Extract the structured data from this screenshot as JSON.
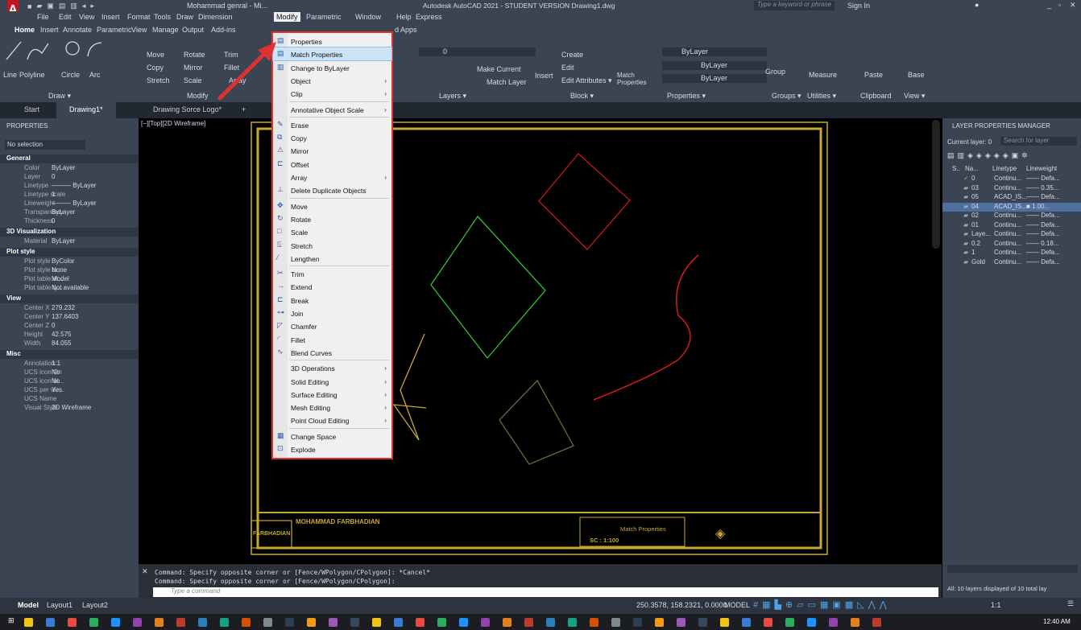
{
  "window": {
    "title": "Autodesk AutoCAD 2021 - STUDENT VERSION Drawing1.dwg",
    "user": "Mohammad genral - Mi...",
    "search_placeholder": "Type a keyword or phrase",
    "sign_in": "Sign In"
  },
  "menubar": [
    "File",
    "Edit",
    "View",
    "Insert",
    "Format",
    "Tools",
    "Draw",
    "Dimension",
    "Modify",
    "Parametric",
    "Window",
    "Help",
    "Express"
  ],
  "ribbon_tabs": [
    "Home",
    "Insert",
    "Annotate",
    "Parametric",
    "View",
    "Manage",
    "Output",
    "Add-ins",
    "d Apps"
  ],
  "ribbon": {
    "draw_tools": [
      "Line",
      "Polyline",
      "Circle",
      "Arc"
    ],
    "draw_panel": "Draw ▾",
    "modify_tools": [
      "Move",
      "Rotate",
      "Trim",
      "Copy",
      "Mirror",
      "Fillet",
      "Stretch",
      "Scale",
      "Array"
    ],
    "modify_panel": "Modify",
    "layers_panel": "Layers ▾",
    "layer_value": "0",
    "match_layer": "Match Layer",
    "make_current": "Make Current",
    "block_panel": "Block ▾",
    "insert": "Insert",
    "create": "Create",
    "edit": "Edit",
    "edit_attributes": "Edit Attributes ▾",
    "properties_panel": "Properties ▾",
    "match_props": "Match Properties",
    "bylayer": "ByLayer",
    "groups": "Groups ▾",
    "group": "Group",
    "utilities": "Utilities ▾",
    "measure": "Measure",
    "clipboard": "Clipboard",
    "paste": "Paste",
    "view": "View ▾",
    "base": "Base"
  },
  "doc_tabs": [
    "Start",
    "Drawing1*",
    "Drawing Sorce Logo*"
  ],
  "viewport_label": "[−][Top][2D Wireframe]",
  "properties": {
    "title": "PROPERTIES",
    "selection": "No selection",
    "general": [
      [
        "Color",
        "ByLayer"
      ],
      [
        "Layer",
        "0"
      ],
      [
        "Linetype",
        "——— ByLayer"
      ],
      [
        "Linetype scale",
        "1"
      ],
      [
        "Lineweight",
        "——— ByLayer"
      ],
      [
        "Transparency",
        "ByLayer"
      ],
      [
        "Thickness",
        "0"
      ]
    ],
    "viz": [
      [
        "Material",
        "ByLayer"
      ]
    ],
    "plot": [
      [
        "Plot style",
        "ByColor"
      ],
      [
        "Plot style ta...",
        "None"
      ],
      [
        "Plot table at...",
        "Model"
      ],
      [
        "Plot table ty...",
        "Not available"
      ]
    ],
    "view": [
      [
        "Center X",
        "279.232"
      ],
      [
        "Center Y",
        "137.6403"
      ],
      [
        "Center Z",
        "0"
      ],
      [
        "Height",
        "42.575"
      ],
      [
        "Width",
        "84.055"
      ]
    ],
    "misc": [
      [
        "Annotation...",
        "1:1"
      ],
      [
        "UCS icon On",
        "No"
      ],
      [
        "UCS icon at...",
        "No"
      ],
      [
        "UCS per vie...",
        "Yes"
      ],
      [
        "UCS Name",
        ""
      ],
      [
        "Visual Style",
        "2D Wireframe"
      ]
    ],
    "sections": [
      "General",
      "3D Visualization",
      "Plot style",
      "View",
      "Misc"
    ]
  },
  "menu": {
    "items": [
      "Properties",
      "Match Properties",
      "Change to ByLayer",
      "Object",
      "Clip",
      "Annotative Object Scale",
      "Erase",
      "Copy",
      "Mirror",
      "Offset",
      "Array",
      "Delete Duplicate Objects",
      "Move",
      "Rotate",
      "Scale",
      "Stretch",
      "Lengthen",
      "Trim",
      "Extend",
      "Break",
      "Join",
      "Chamfer",
      "Fillet",
      "Blend Curves",
      "3D Operations",
      "Solid Editing",
      "Surface Editing",
      "Mesh Editing",
      "Point Cloud Editing",
      "Change Space",
      "Explode"
    ]
  },
  "layers": {
    "title": "LAYER PROPERTIES MANAGER",
    "current": "Current layer: 0",
    "search_placeholder": "Search for layer",
    "headers": [
      "S..",
      "Na...",
      "Linetype",
      "Lineweight"
    ],
    "rows": [
      [
        "0",
        "Continu...",
        "—— Defa..."
      ],
      [
        "03",
        "Continu...",
        "—— 0.35..."
      ],
      [
        "05",
        "ACAD_IS...",
        "—— Defa..."
      ],
      [
        "04",
        "ACAD_IS...",
        "■ 1.00..."
      ],
      [
        "02",
        "Continu...",
        "—— Defa..."
      ],
      [
        "01",
        "Continu...",
        "—— Defa..."
      ],
      [
        "Laye...",
        "Continu...",
        "—— Defa..."
      ],
      [
        "0.2",
        "Continu...",
        "—— 0.18..."
      ],
      [
        "1",
        "Continu...",
        "—— Defa..."
      ],
      [
        "Gold",
        "Continu...",
        "—— Defa..."
      ]
    ],
    "footer": "All: 10 layers displayed of 10 total lay"
  },
  "title_block": {
    "name": "MOHAMMAD FARBHADIAN",
    "logo": "FARBHADIAN",
    "match": "Match Properties",
    "scale": "SC : 1:100"
  },
  "command": {
    "line1": "Command: Specify opposite corner or [Fence/WPolygon/CPolygon]: *Cancel*",
    "line2": "Command: Specify opposite corner or [Fence/WPolygon/CPolygon]:",
    "placeholder": "Type a command"
  },
  "status": {
    "model": "Model",
    "layout1": "Layout1",
    "layout2": "Layout2",
    "coords": "250.3578, 158.2321, 0.0000",
    "mode": "MODEL",
    "scale": "1:1"
  },
  "clock": "12:40 AM",
  "colors": {
    "accent": "#e03131",
    "yellow": "#c8a832",
    "green": "#2ec42e",
    "red": "#c41a1a"
  }
}
